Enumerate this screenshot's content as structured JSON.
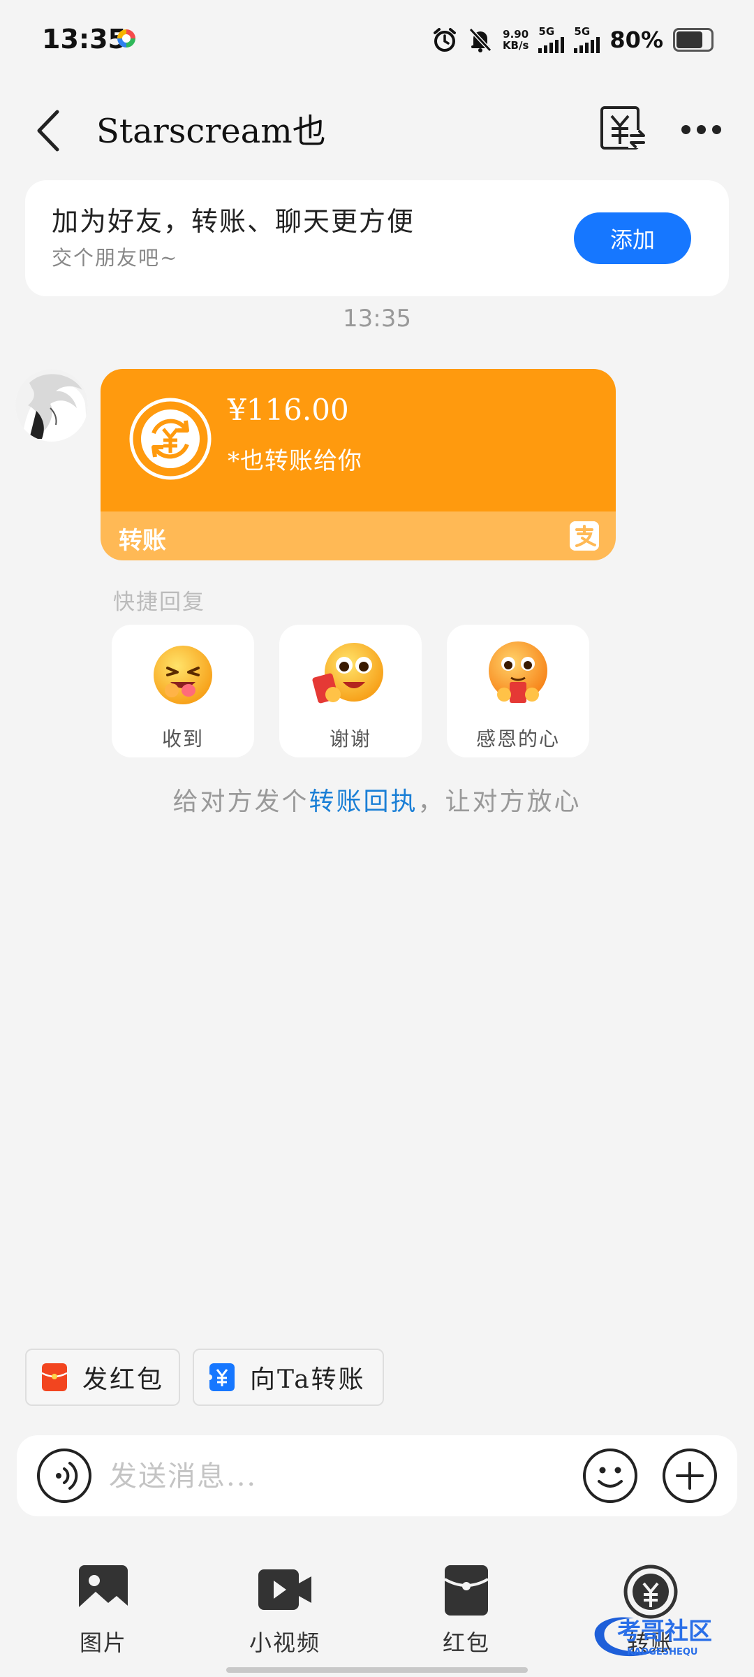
{
  "status_bar": {
    "time": "13:35",
    "net_speed_value": "9.90",
    "net_speed_unit": "KB/s",
    "sim1_label": "5G",
    "sim2_label": "5G",
    "battery": "80%"
  },
  "header": {
    "title": "Starscream也"
  },
  "banner": {
    "title": "加为好友，转账、聊天更方便",
    "subtitle": "交个朋友吧~",
    "add_label": "添加"
  },
  "chat": {
    "timestamp": "13:35",
    "transfer": {
      "amount": "¥116.00",
      "memo": "*也转账给你",
      "label": "转账"
    },
    "quick_reply_label": "快捷回复",
    "quick_replies": [
      {
        "label": "收到"
      },
      {
        "label": "谢谢"
      },
      {
        "label": "感恩的心"
      }
    ],
    "receipt_tip_before": "给对方发个",
    "receipt_tip_link": "转账回执",
    "receipt_tip_after": "，让对方放心"
  },
  "actions": {
    "red_packet": "发红包",
    "transfer_to": "向Ta转账"
  },
  "input": {
    "placeholder": "发送消息..."
  },
  "tools": [
    {
      "label": "图片"
    },
    {
      "label": "小视频"
    },
    {
      "label": "红包"
    },
    {
      "label": "转账"
    }
  ],
  "watermark": {
    "main": "考哥社区",
    "sub": "KAOGESHEQU"
  },
  "colors": {
    "accent_blue": "#1677ff",
    "transfer_orange": "#ff9a0e",
    "transfer_orange_light": "#ffb955",
    "link_blue": "#1a7fd6",
    "red_packet": "#f2451f"
  }
}
